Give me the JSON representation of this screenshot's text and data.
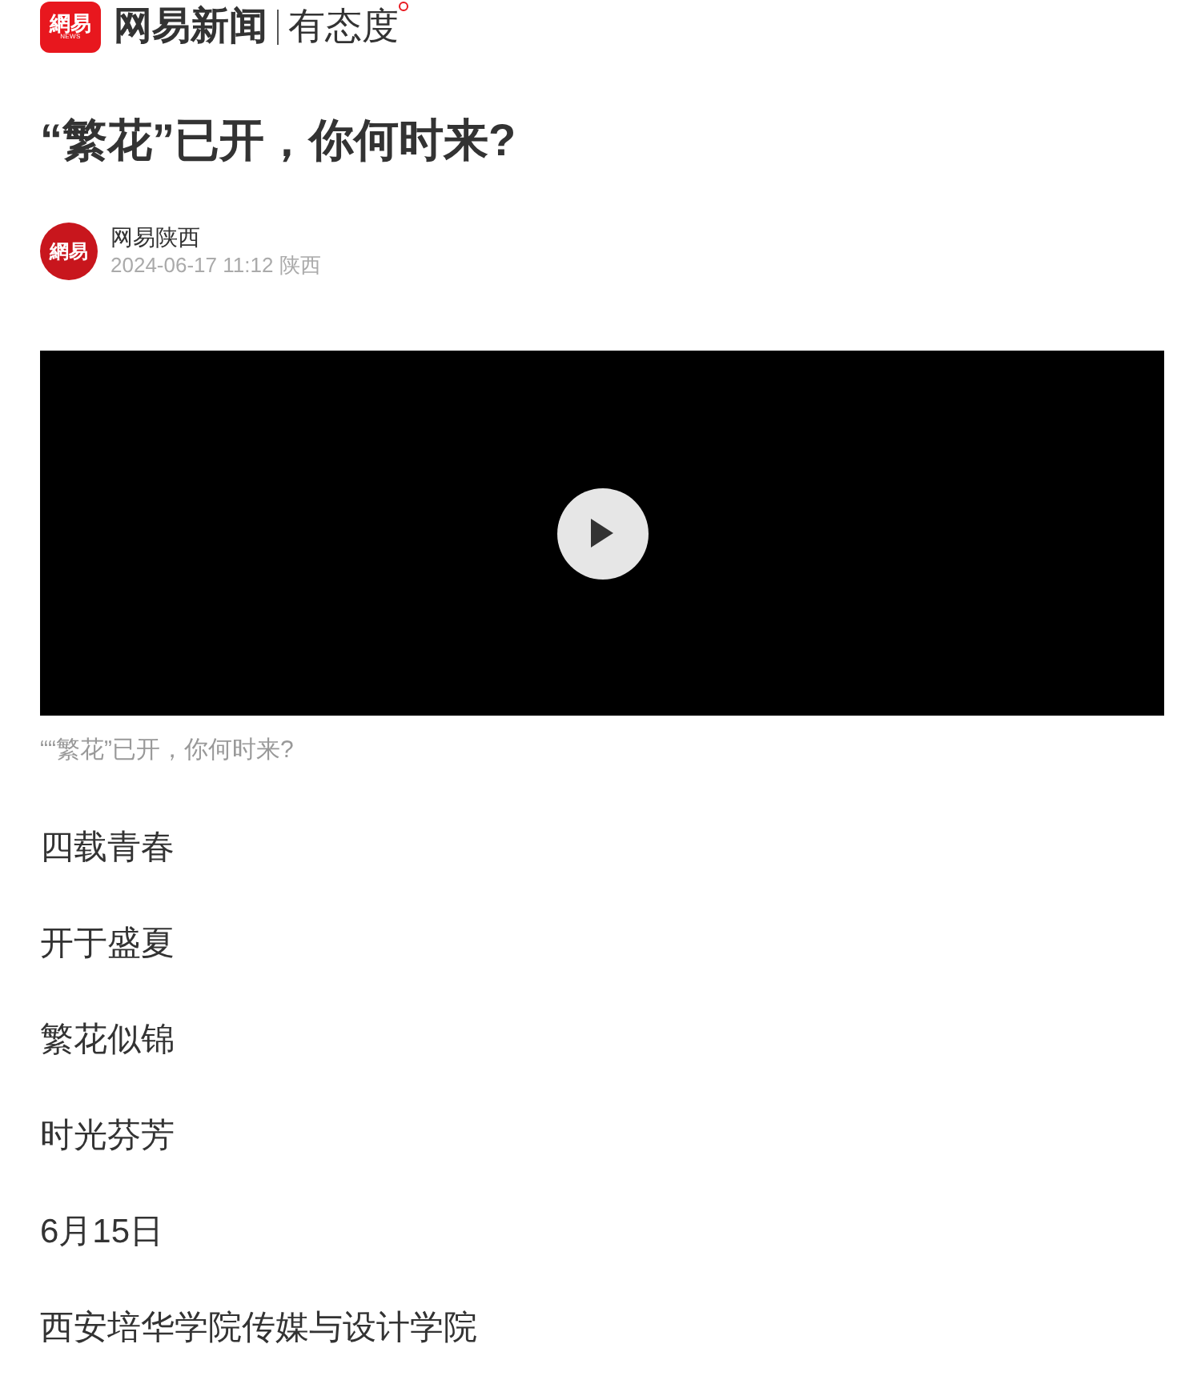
{
  "header": {
    "logo_text": "網易",
    "logo_subtext": "NEWS",
    "brand": "网易新闻",
    "slogan": "有态度"
  },
  "article": {
    "title": "“繁花”已开，你何时来?",
    "author": {
      "avatar_text": "網易",
      "name": "网易陕西",
      "meta": "2024-06-17 11:12 陕西"
    },
    "video": {
      "playing": false,
      "caption": "““繁花”已开，你何时来?"
    },
    "paragraphs": [
      "四载青春",
      "开于盛夏",
      "繁花似锦",
      "时光芬芳",
      "6月15日",
      "西安培华学院传媒与设计学院"
    ]
  }
}
